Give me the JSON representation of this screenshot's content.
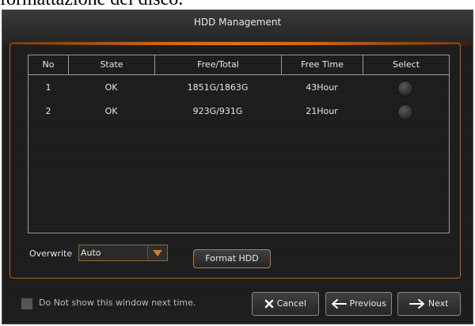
{
  "caption": "formattazione del disco.",
  "window": {
    "title": "HDD Management"
  },
  "table": {
    "headers": [
      "No",
      "State",
      "Free/Total",
      "Free Time",
      "Select"
    ],
    "rows": [
      {
        "no": "1",
        "state": "OK",
        "free_total": "1851G/1863G",
        "free_time": "43Hour"
      },
      {
        "no": "2",
        "state": "OK",
        "free_total": "923G/931G",
        "free_time": "21Hour"
      }
    ]
  },
  "overwrite": {
    "label": "Overwrite",
    "value": "Auto"
  },
  "format_button": "Format HDD",
  "dont_show": {
    "label": "Do Not show this window next time.",
    "checked": false
  },
  "buttons": {
    "cancel": "Cancel",
    "previous": "Previous",
    "next": "Next"
  },
  "icons": {
    "cancel": "x-icon",
    "previous": "arrow-left-icon",
    "next": "arrow-right-icon",
    "dropdown": "chevron-down-icon"
  },
  "colors": {
    "accent": "#e07a1f",
    "background": "#1c1c1c",
    "text": "#e6e6e6"
  }
}
